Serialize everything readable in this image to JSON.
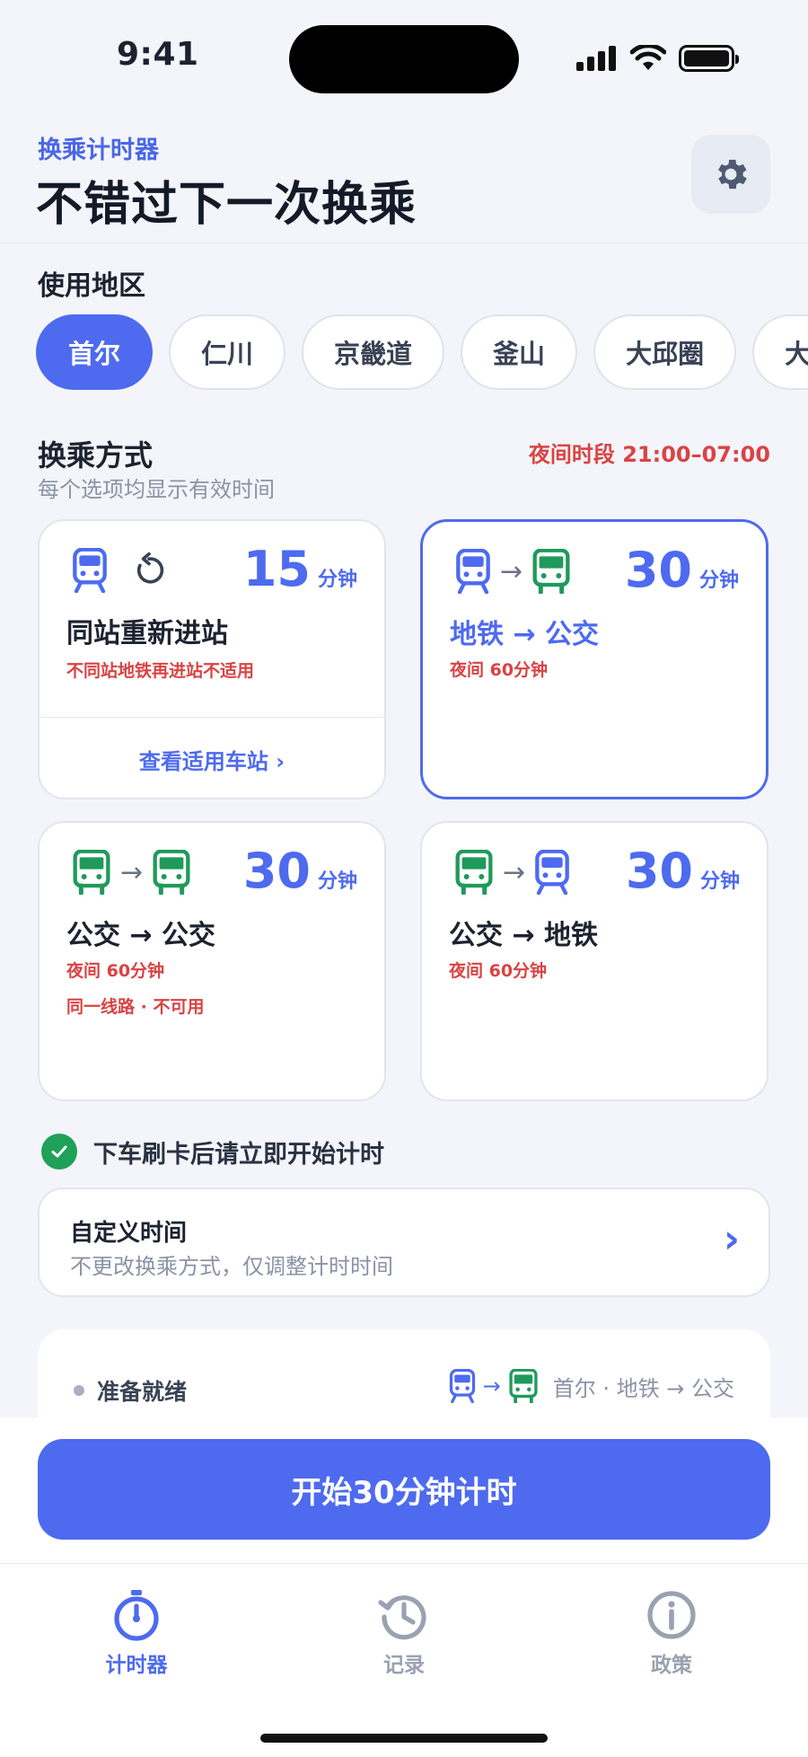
{
  "status_bar": {
    "time": "9:41"
  },
  "header": {
    "eyebrow": "换乘计时器",
    "title": "不错过下一次换乘"
  },
  "region": {
    "label": "使用地区",
    "chips": [
      "首尔",
      "仁川",
      "京畿道",
      "釜山",
      "大邱圈",
      "大"
    ],
    "selected": "首尔"
  },
  "transfer": {
    "title": "换乘方式",
    "subtitle": "每个选项均显示有效时间",
    "night_label": "夜间时段 21:00–07:00",
    "unit": "分钟",
    "cards": [
      {
        "minutes": "15",
        "title": "同站重新进站",
        "note1": "不同站地铁再进站不适用",
        "link": "查看适用车站 ›",
        "icons": [
          "subway-icon",
          "reentry-icon"
        ]
      },
      {
        "minutes": "30",
        "title": "地铁 → 公交",
        "note1": "夜间 60分钟",
        "icons": [
          "subway-icon",
          "arrow-icon",
          "bus-icon"
        ],
        "selected": true
      },
      {
        "minutes": "30",
        "title": "公交 → 公交",
        "note1": "夜间 60分钟",
        "note2": "同一线路 · 不可用",
        "icons": [
          "bus-icon",
          "arrow-icon",
          "bus-icon"
        ]
      },
      {
        "minutes": "30",
        "title": "公交 → 地铁",
        "note1": "夜间 60分钟",
        "icons": [
          "bus-icon",
          "arrow-icon",
          "subway-icon"
        ]
      }
    ]
  },
  "hint": "下车刷卡后请立即开始计时",
  "custom_time": {
    "title": "自定义时间",
    "subtitle": "不更改换乘方式，仅调整计时时间"
  },
  "status_card": {
    "ready": "准备就绪",
    "route": "首尔 · 地铁 → 公交"
  },
  "start_button": "开始30分钟计时",
  "tabs": [
    {
      "label": "计时器",
      "icon": "stopwatch-icon",
      "active": true
    },
    {
      "label": "记录",
      "icon": "history-icon"
    },
    {
      "label": "政策",
      "icon": "info-icon"
    }
  ],
  "colors": {
    "accent": "#4e6bf0",
    "night": "#d94343",
    "bus": "#1f9a5a"
  }
}
